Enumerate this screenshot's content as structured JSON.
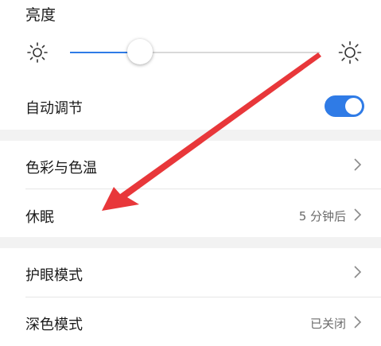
{
  "brightness": {
    "title": "亮度",
    "level_percent": 28,
    "icons": {
      "low": "sun-low-icon",
      "high": "sun-high-icon"
    }
  },
  "auto_adjust": {
    "label": "自动调节",
    "enabled": true
  },
  "items": [
    {
      "label": "色彩与色温",
      "value": ""
    },
    {
      "label": "休眠",
      "value": "5 分钟后"
    },
    {
      "label": "护眼模式",
      "value": ""
    },
    {
      "label": "深色模式",
      "value": "已关闭"
    }
  ],
  "colors": {
    "accent": "#2f7be6",
    "annotation_arrow": "#e8373a"
  }
}
